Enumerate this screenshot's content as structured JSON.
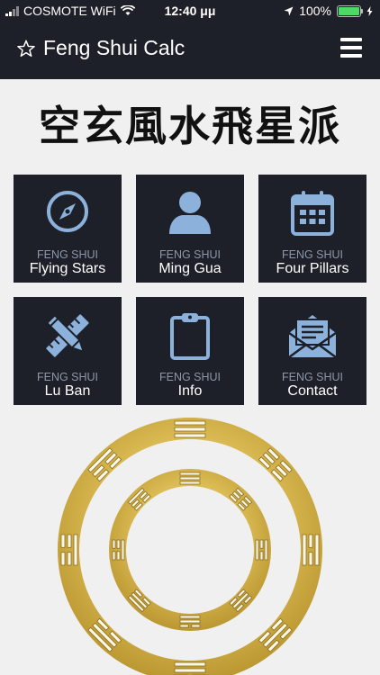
{
  "status": {
    "carrier": "COSMOTE WiFi",
    "time": "12:40 μμ",
    "battery": "100%"
  },
  "nav": {
    "title": "Feng Shui Calc"
  },
  "banner": "空玄風水飛星派",
  "tiles": [
    {
      "sub": "FENG SHUI",
      "label": "Flying Stars",
      "icon": "compass-icon"
    },
    {
      "sub": "FENG SHUI",
      "label": "Ming Gua",
      "icon": "user-icon"
    },
    {
      "sub": "FENG SHUI",
      "label": "Four Pillars",
      "icon": "calendar-icon"
    },
    {
      "sub": "FENG SHUI",
      "label": "Lu Ban",
      "icon": "ruler-pencil-icon"
    },
    {
      "sub": "FENG SHUI",
      "label": "Info",
      "icon": "clipboard-icon"
    },
    {
      "sub": "FENG SHUI",
      "label": "Contact",
      "icon": "envelope-icon"
    }
  ],
  "colors": {
    "bar": "#1d2028",
    "icon": "#8cb2dc",
    "gold": "#d4b24a",
    "battery": "#4cd964"
  }
}
